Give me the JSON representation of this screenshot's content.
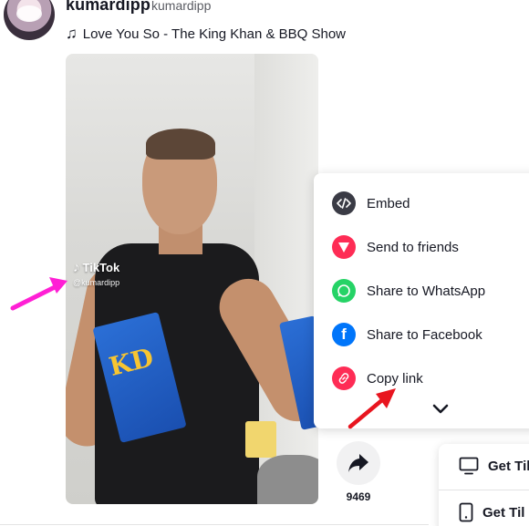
{
  "post": {
    "username": "kumardipp",
    "nickname": "kumardipp",
    "music": "Love You So - The King Khan & BBQ Show",
    "music_icon": "music-note-icon"
  },
  "video": {
    "watermark_brand": "TikTok",
    "watermark_handle": "@kumardipp"
  },
  "share_menu": {
    "items": [
      {
        "label": "Embed",
        "icon": "embed-icon",
        "color": "#3a3b45"
      },
      {
        "label": "Send to friends",
        "icon": "send-icon",
        "color": "#fe2c55"
      },
      {
        "label": "Share to WhatsApp",
        "icon": "whatsapp-icon",
        "color": "#25d366"
      },
      {
        "label": "Share to Facebook",
        "icon": "facebook-icon",
        "color": "#0075fa"
      },
      {
        "label": "Copy link",
        "icon": "link-icon",
        "color": "#fe2c55"
      }
    ],
    "more_icon": "chevron-down-icon"
  },
  "actions": {
    "share_count": "9469",
    "share_icon": "share-arrow-icon"
  },
  "get_app": {
    "desktop_label": "Get Til",
    "mobile_label": "Get Til"
  },
  "annotations": {
    "left_arrow_color": "#ff1fd5",
    "red_arrow_color": "#e8151f"
  }
}
